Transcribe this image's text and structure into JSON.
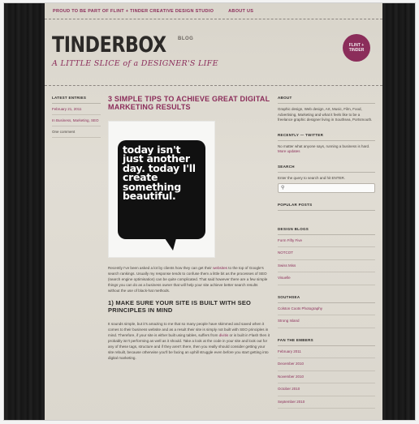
{
  "nav": {
    "item1": "PROUD TO BE PART OF FLINT + TINDER CREATIVE DESIGN STUDIO",
    "item2": "ABOUT US"
  },
  "header": {
    "logo": "TINDERBOX",
    "logo_suffix": "BLOG",
    "tagline": "A LITTLE SLICE of a DESIGNER'S LIFE",
    "badge": "FLINT + TINDER"
  },
  "left": {
    "heading": "LATEST ENTRIES",
    "date": "February 21, 2011",
    "category": "In Business, Marketing, SEO",
    "comments": "One comment"
  },
  "post": {
    "title": "3 SIMPLE TIPS TO ACHIEVE GREAT DIGITAL MARKETING RESULTS",
    "poster_text": "today isn't just another day. today I'll create something beautiful.",
    "p1_a": "Recently I've been asked a lot by clients how they can get their ",
    "p1_link": "websites",
    "p1_b": " to the top of Google's search rankings. Usually my response tends to confuse them a little bit as the processes of SEO (search engine optimisation) can be quite complicated. That said however there are a few simple things you can do as a business owner that will help your site achieve better search results without the use of black-hat methods.",
    "h2": "1) MAKE SURE YOUR SITE IS BUILT WITH SEO PRINCIPLES IN MIND",
    "p2_a": "It sounds simple, but it's amazing to me that so many people have skimmed and saved when it comes to their business website and as a result their site is simply not built with SEO principles in mind. Therefore, if your site is either built using tables, suffers from ",
    "p2_link": "divitis",
    "p2_b": " or is built in Flash then it probably isn't performing as well as it should. Take a look at the code in your site and look out for any of these tags, structure and if they aren't there, then you really should consider getting your site rebuilt, because otherwise you'll be facing an uphill struggle even before you start getting into digital marketing."
  },
  "right": {
    "about_heading": "ABOUT",
    "about_text": "Graphic design, Web design, Art, Music, Film, Food, Advertising, Marketing and what it feels like to be a freelance graphic designer living in Southsea, Portsmouth.",
    "twitter_heading": "RECENTLY — TWITTER",
    "twitter_text": "No matter what anyone says, running a business is hard.",
    "twitter_link": "More updates",
    "search_heading": "SEARCH",
    "search_hint": "Enter the query to search and hit ENTER.",
    "search_placeholder": "",
    "popular_heading": "POPULAR POSTS",
    "design_heading": "DESIGN BLOGS",
    "design_links": [
      "Form Fifty Five",
      "NOTCOT",
      "Swiss Miss",
      "Visuelle"
    ],
    "southsea_heading": "SOUTHSEA",
    "southsea_links": [
      "Colston Coots Photography",
      "Strong Island"
    ],
    "embers_heading": "FAN THE EMBERS",
    "embers_links": [
      "February 2011",
      "December 2010",
      "November 2010",
      "October 2010",
      "September 2010"
    ]
  }
}
